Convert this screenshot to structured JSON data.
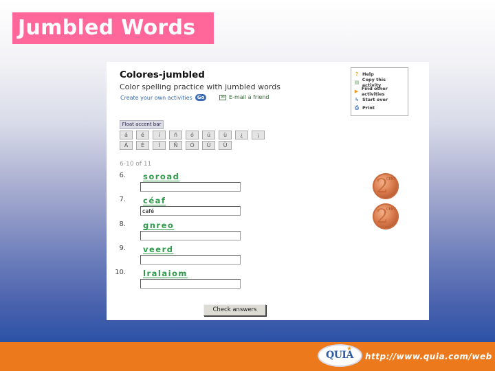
{
  "slide": {
    "title": "Jumbled Words",
    "footer_url": "http://www.quia.com/web",
    "logo_text": "QUIA",
    "colors": {
      "title_badge": "#ff6699",
      "footer_orange": "#ec7a1c",
      "footer_blue": "#2b52a6",
      "word_green": "#2e9a4a"
    }
  },
  "activity": {
    "title": "Colores-jumbled",
    "subtitle": "Color spelling practice with jumbled words",
    "create_link": "Create your own activities",
    "go_label": "Go",
    "email_link": "E-mail a friend",
    "menu": [
      {
        "icon": "help-icon",
        "glyph": "?",
        "label": "Help"
      },
      {
        "icon": "copy-icon",
        "glyph": "▤",
        "label": "Copy this activity"
      },
      {
        "icon": "arrow-right-icon",
        "glyph": "▶",
        "label": "Find other activities"
      },
      {
        "icon": "start-over-icon",
        "glyph": "↳",
        "label": "Start over"
      },
      {
        "icon": "print-icon",
        "glyph": "⎙",
        "label": "Print"
      }
    ],
    "float_accent_label": "Float accent bar",
    "accent_row_1": [
      "á",
      "é",
      "í",
      "ñ",
      "ó",
      "ú",
      "ü",
      "¿",
      "¡"
    ],
    "accent_row_2": [
      "Á",
      "É",
      "Í",
      "Ñ",
      "Ó",
      "Ú",
      "Ü"
    ],
    "pager": "6-10 of 11",
    "questions": [
      {
        "num": "6.",
        "word": "soroad",
        "answer": ""
      },
      {
        "num": "7.",
        "word": "céaf",
        "answer": "café"
      },
      {
        "num": "8.",
        "word": "gnreo",
        "answer": ""
      },
      {
        "num": "9.",
        "word": "veerd",
        "answer": ""
      },
      {
        "num": "10.",
        "word": "lralaiom",
        "answer": ""
      }
    ],
    "check_label": "Check answers",
    "coin_value": "2",
    "coin_unit": "CENT"
  }
}
